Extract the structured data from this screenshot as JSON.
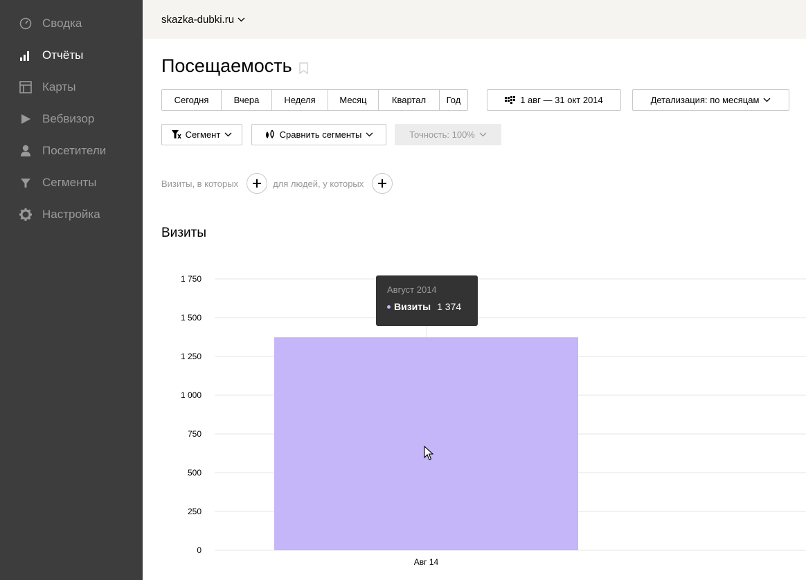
{
  "sidebar": {
    "items": [
      {
        "label": "Сводка",
        "icon": "gauge-icon",
        "active": false
      },
      {
        "label": "Отчёты",
        "icon": "bar-chart-icon",
        "active": true
      },
      {
        "label": "Карты",
        "icon": "map-layout-icon",
        "active": false
      },
      {
        "label": "Вебвизор",
        "icon": "play-icon",
        "active": false
      },
      {
        "label": "Посетители",
        "icon": "person-icon",
        "active": false
      },
      {
        "label": "Сегменты",
        "icon": "filter-icon",
        "active": false
      },
      {
        "label": "Настройка",
        "icon": "gear-icon",
        "active": false
      }
    ]
  },
  "header": {
    "site": "skazka-dubki.ru"
  },
  "page": {
    "title": "Посещаемость"
  },
  "toolbar": {
    "periods": [
      "Сегодня",
      "Вчера",
      "Неделя",
      "Месяц",
      "Квартал",
      "Год"
    ],
    "date_range": "1 авг — 31 окт 2014",
    "detail": "Детализация: по месяцам",
    "segment": "Сегмент",
    "compare": "Сравнить сегменты",
    "accuracy": "Точность: 100%"
  },
  "filters": {
    "visits_label": "Визиты, в которых",
    "people_label": "для людей, у которых"
  },
  "section": {
    "title": "Визиты"
  },
  "chart_data": {
    "type": "bar",
    "title": "Визиты",
    "categories": [
      "Авг 14"
    ],
    "series": [
      {
        "name": "Визиты",
        "values": [
          1374
        ],
        "color": "#c5b5f9"
      }
    ],
    "ylim": [
      0,
      1750
    ],
    "yticks": [
      "0",
      "250",
      "500",
      "750",
      "1 000",
      "1 250",
      "1 500",
      "1 750"
    ],
    "grid": true
  },
  "tooltip": {
    "title": "Август 2014",
    "label": "Визиты",
    "value": "1 374"
  }
}
